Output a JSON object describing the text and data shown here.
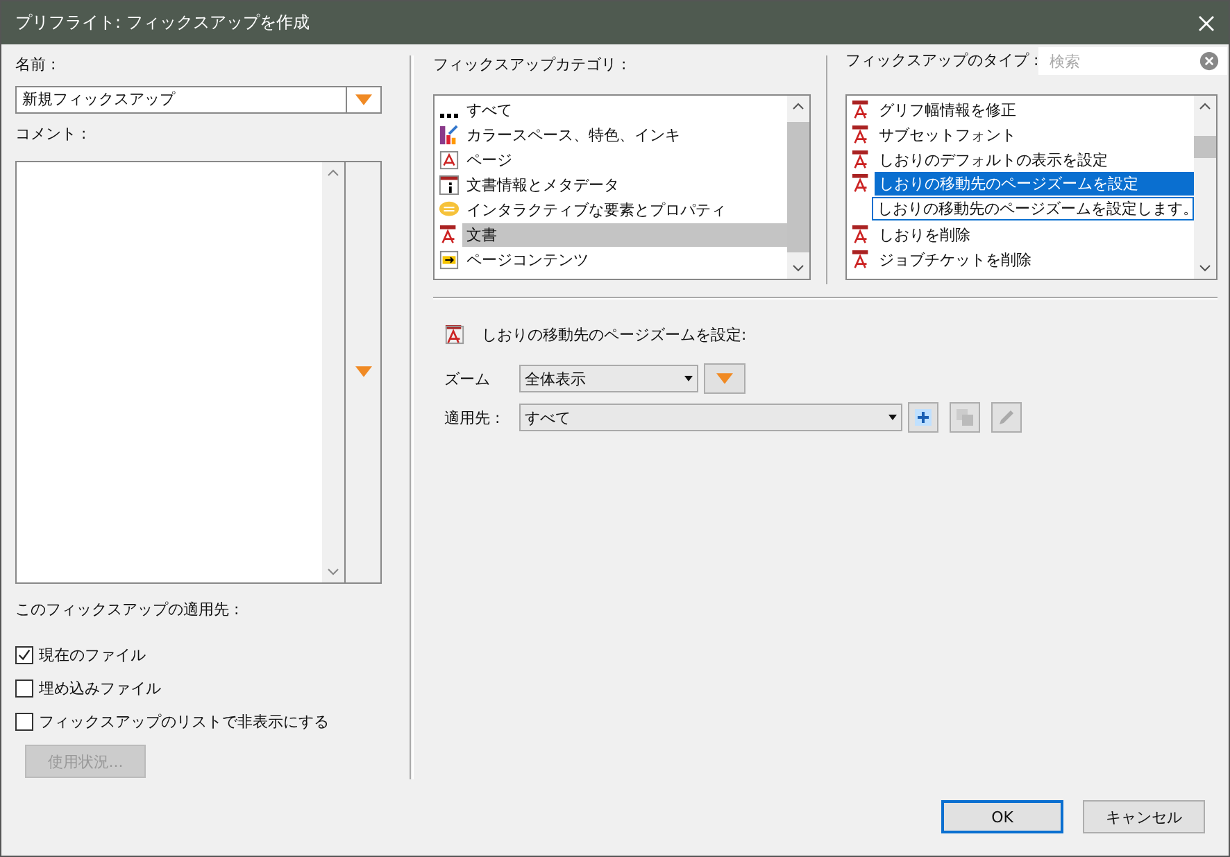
{
  "window": {
    "title": "プリフライト: フィックスアップを作成"
  },
  "name": {
    "label": "名前 :",
    "value": "新規フィックスアップ"
  },
  "comment": {
    "label": "コメント :"
  },
  "apply_to": {
    "label": "このフィックスアップの適用先 :",
    "options": [
      {
        "label": "現在のファイル",
        "checked": true
      },
      {
        "label": "埋め込みファイル",
        "checked": false
      },
      {
        "label": "フィックスアップのリストで非表示にする",
        "checked": false
      }
    ]
  },
  "usage_button": {
    "label": "使用状況...",
    "disabled": true
  },
  "categories": {
    "label": "フィックスアップカテゴリ :",
    "items": [
      {
        "label": "すべて",
        "kind": "dots",
        "selected": false
      },
      {
        "label": "カラースペース、特色、インキ",
        "kind": "color",
        "selected": false
      },
      {
        "label": "ページ",
        "kind": "page",
        "selected": false
      },
      {
        "label": "文書情報とメタデータ",
        "kind": "info",
        "selected": false
      },
      {
        "label": "インタラクティブな要素とプロパティ",
        "kind": "chat",
        "selected": false
      },
      {
        "label": "文書",
        "kind": "pdf",
        "selected": true
      },
      {
        "label": "ページコンテンツ",
        "kind": "arrow",
        "selected": false
      }
    ]
  },
  "types": {
    "label": "フィックスアップのタイプ :",
    "search_placeholder": "検索",
    "tooltip": "しおりの移動先のページズームを設定します。",
    "items": [
      {
        "label": "グリフ幅情報を修正",
        "selected": false
      },
      {
        "label": "サブセットフォント",
        "selected": false
      },
      {
        "label": "しおりのデフォルトの表示を設定",
        "selected": false
      },
      {
        "label": "しおりの移動先のページズームを設定",
        "selected": true
      },
      {
        "label": "しおりを削除",
        "selected": false
      },
      {
        "label": "ジョブチケットを削除",
        "selected": false
      }
    ]
  },
  "detail": {
    "heading": "しおりの移動先のページズームを設定:",
    "zoom_label": "ズーム",
    "zoom_value": "全体表示",
    "target_label": "適用先 :",
    "target_value": "すべて"
  },
  "buttons": [
    {
      "label": "OK",
      "kind": "default"
    },
    {
      "label": "キャンセル",
      "kind": "normal"
    }
  ]
}
